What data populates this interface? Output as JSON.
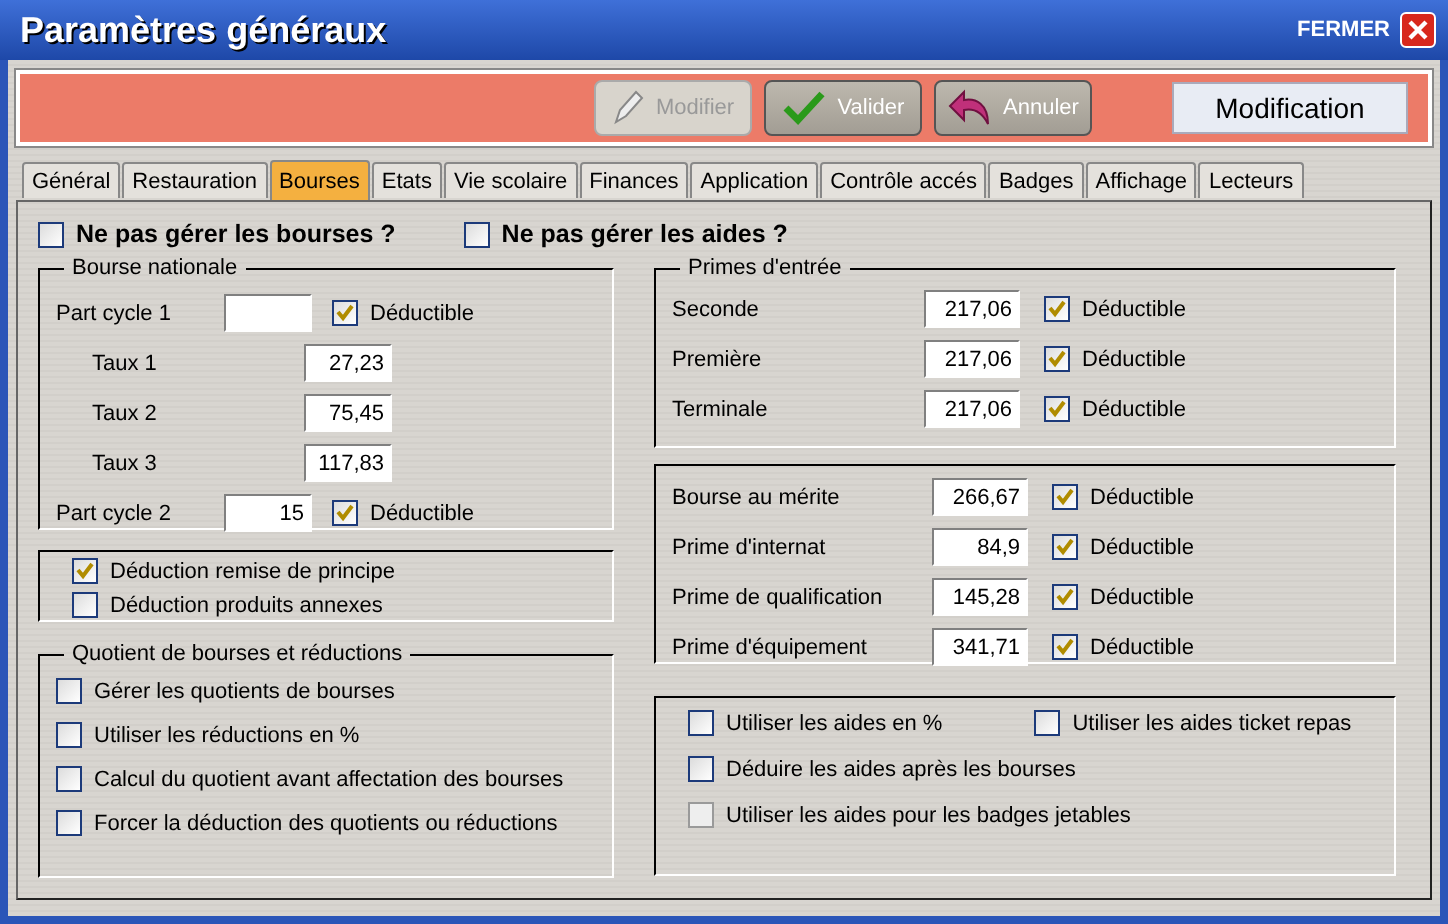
{
  "window": {
    "title": "Paramètres généraux",
    "close_label": "FERMER"
  },
  "toolbar": {
    "buttons": [
      {
        "kind": "edit",
        "label": "Modifier",
        "disabled": true
      },
      {
        "kind": "ok",
        "label": "Valider",
        "disabled": false
      },
      {
        "kind": "undo",
        "label": "Annuler",
        "disabled": false
      }
    ],
    "mode": "Modification"
  },
  "tabs": [
    {
      "label": "Général",
      "selected": false
    },
    {
      "label": "Restauration",
      "selected": false
    },
    {
      "label": "Bourses",
      "selected": true
    },
    {
      "label": "Etats",
      "selected": false
    },
    {
      "label": "Vie scolaire",
      "selected": false
    },
    {
      "label": "Finances",
      "selected": false
    },
    {
      "label": "Application",
      "selected": false
    },
    {
      "label": "Contrôle accés",
      "selected": false
    },
    {
      "label": "Badges",
      "selected": false
    },
    {
      "label": "Affichage",
      "selected": false
    },
    {
      "label": "Lecteurs",
      "selected": false
    }
  ],
  "top_options": [
    {
      "label": "Ne pas gérer les bourses ?",
      "checked": false
    },
    {
      "label": "Ne pas gérer les aides ?",
      "checked": false
    }
  ],
  "bourse_nationale": {
    "title": "Bourse nationale",
    "rows": [
      {
        "kind": "part",
        "label": "Part cycle 1",
        "value": "",
        "deductible": {
          "label": "Déductible",
          "checked": true
        }
      },
      {
        "kind": "taux",
        "label": "Taux 1",
        "value": "27,23"
      },
      {
        "kind": "taux",
        "label": "Taux 2",
        "value": "75,45"
      },
      {
        "kind": "taux",
        "label": "Taux 3",
        "value": "117,83"
      },
      {
        "kind": "part",
        "label": "Part cycle 2",
        "value": "15",
        "deductible": {
          "label": "Déductible",
          "checked": true
        }
      }
    ]
  },
  "deductions": [
    {
      "label": "Déduction remise de principe",
      "checked": true
    },
    {
      "label": "Déduction produits annexes",
      "checked": false
    }
  ],
  "quotient": {
    "title": "Quotient de bourses et réductions",
    "options": [
      {
        "label": "Gérer les quotients de bourses",
        "checked": false
      },
      {
        "label": "Utiliser les réductions en %",
        "checked": false
      },
      {
        "label": "Calcul du quotient avant affectation des bourses",
        "checked": false
      },
      {
        "label": "Forcer la déduction des quotients ou réductions",
        "checked": false
      }
    ]
  },
  "primes_entree": {
    "title": "Primes d'entrée",
    "rows": [
      {
        "label": "Seconde",
        "value": "217,06",
        "deductible": {
          "label": "Déductible",
          "checked": true
        }
      },
      {
        "label": "Première",
        "value": "217,06",
        "deductible": {
          "label": "Déductible",
          "checked": true
        }
      },
      {
        "label": "Terminale",
        "value": "217,06",
        "deductible": {
          "label": "Déductible",
          "checked": true
        }
      }
    ]
  },
  "aides": [
    {
      "label": "Bourse au mérite",
      "value": "266,67",
      "deductible": {
        "label": "Déductible",
        "checked": true
      }
    },
    {
      "label": "Prime d'internat",
      "value": "84,9",
      "deductible": {
        "label": "Déductible",
        "checked": true
      }
    },
    {
      "label": "Prime de qualification",
      "value": "145,28",
      "deductible": {
        "label": "Déductible",
        "checked": true
      }
    },
    {
      "label": "Prime d'équipement",
      "value": "341,71",
      "deductible": {
        "label": "Déductible",
        "checked": true
      }
    }
  ],
  "aide_options": [
    [
      {
        "label": "Utiliser les aides en %",
        "checked": false,
        "disabled": false
      },
      {
        "label": "Utiliser les aides ticket repas",
        "checked": false,
        "disabled": false
      }
    ],
    [
      {
        "label": "Déduire les aides après les bourses",
        "checked": false,
        "disabled": false
      }
    ],
    [
      {
        "label": "Utiliser les aides pour les badges jetables",
        "checked": false,
        "disabled": true
      }
    ]
  ]
}
